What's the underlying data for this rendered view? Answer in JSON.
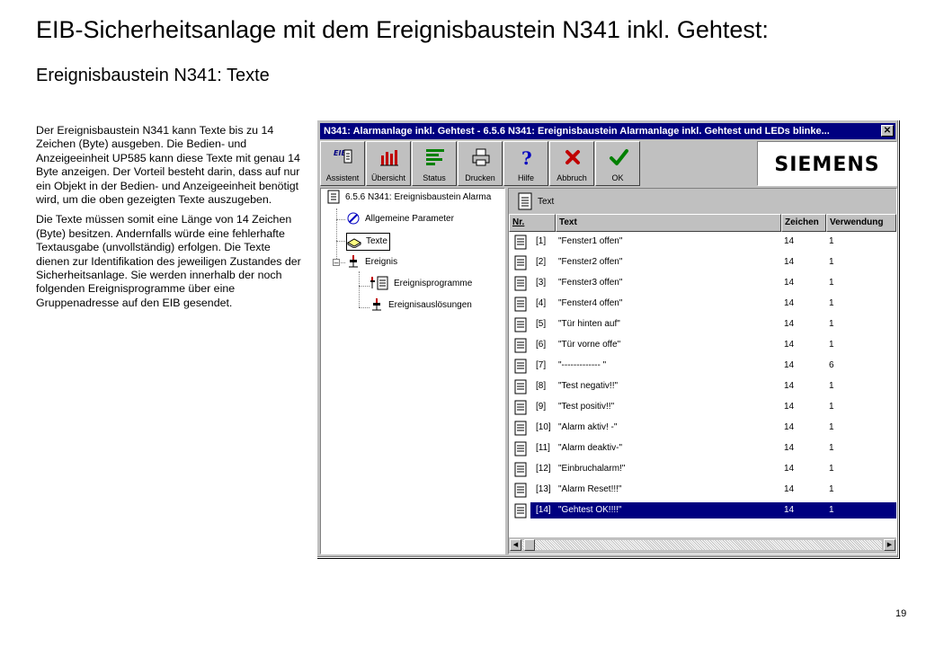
{
  "slide": {
    "title": "EIB-Sicherheitsanlage mit dem Ereignisbaustein N341 inkl. Gehtest:",
    "subtitle": "Ereignisbaustein N341: Texte",
    "paragraph1": "Der Ereignisbaustein N341 kann Texte bis zu 14 Zeichen (Byte) ausgeben. Die Bedien- und Anzeigeeinheit UP585 kann diese Texte mit genau 14 Byte anzeigen. Der Vorteil besteht darin, dass auf nur ein Objekt in der Bedien- und Anzeigeeinheit benötigt wird, um die oben gezeigten Texte auszugeben.",
    "paragraph2": "Die Texte müssen somit eine Länge von 14 Zeichen (Byte) besitzen. Andernfalls würde eine fehlerhafte Textausgabe (unvollständig) erfolgen. Die Texte dienen zur Identifikation des jeweiligen Zustandes der Sicherheitsanlage. Sie werden innerhalb der noch folgenden Ereignisprogramme über eine Gruppenadresse auf den EIB gesendet.",
    "page_number": "19"
  },
  "window": {
    "title": "N341: Alarmanlage inkl. Gehtest - 6.5.6  N341: Ereignisbaustein Alarmanlage inkl. Gehtest und LEDs blinke...",
    "close_glyph": "✕",
    "logo": "SIEMENS"
  },
  "toolbar": {
    "buttons": [
      {
        "label": "Assistent",
        "icon": "eib-assistant-icon"
      },
      {
        "label": "Übersicht",
        "icon": "overview-chart-icon"
      },
      {
        "label": "Status",
        "icon": "status-bars-icon"
      },
      {
        "label": "Drucken",
        "icon": "printer-icon"
      },
      {
        "label": "Hilfe",
        "icon": "help-question-icon"
      },
      {
        "label": "Abbruch",
        "icon": "cancel-x-icon"
      },
      {
        "label": "OK",
        "icon": "ok-check-icon"
      }
    ]
  },
  "tree": {
    "root": "6.5.6  N341: Ereignisbaustein Alarma",
    "items": [
      {
        "label": "Allgemeine Parameter"
      },
      {
        "label": "Texte"
      },
      {
        "label": "Ereignis"
      },
      {
        "label": "Ereignisprogramme"
      },
      {
        "label": "Ereignisauslösungen"
      }
    ]
  },
  "panel": {
    "header_label": "Text",
    "columns": [
      "Nr.",
      "Text",
      "Zeichen",
      "Verwendung"
    ],
    "rows": [
      {
        "nr": "[1]",
        "text": "\"Fenster1 offen\"",
        "zeichen": "14",
        "verwendung": "1"
      },
      {
        "nr": "[2]",
        "text": "\"Fenster2 offen\"",
        "zeichen": "14",
        "verwendung": "1"
      },
      {
        "nr": "[3]",
        "text": "\"Fenster3 offen\"",
        "zeichen": "14",
        "verwendung": "1"
      },
      {
        "nr": "[4]",
        "text": "\"Fenster4 offen\"",
        "zeichen": "14",
        "verwendung": "1"
      },
      {
        "nr": "[5]",
        "text": "\"Tür hinten auf\"",
        "zeichen": "14",
        "verwendung": "1"
      },
      {
        "nr": "[6]",
        "text": "\"Tür vorne offe\"",
        "zeichen": "14",
        "verwendung": "1"
      },
      {
        "nr": "[7]",
        "text": "\"------------- \"",
        "zeichen": "14",
        "verwendung": "6"
      },
      {
        "nr": "[8]",
        "text": "\"Test negativ!!\"",
        "zeichen": "14",
        "verwendung": "1"
      },
      {
        "nr": "[9]",
        "text": "\"Test positiv!!\"",
        "zeichen": "14",
        "verwendung": "1"
      },
      {
        "nr": "[10]",
        "text": "\"Alarm aktiv! -\"",
        "zeichen": "14",
        "verwendung": "1"
      },
      {
        "nr": "[11]",
        "text": "\"Alarm deaktiv-\"",
        "zeichen": "14",
        "verwendung": "1"
      },
      {
        "nr": "[12]",
        "text": "\"Einbruchalarm!\"",
        "zeichen": "14",
        "verwendung": "1"
      },
      {
        "nr": "[13]",
        "text": "\"Alarm Reset!!!\"",
        "zeichen": "14",
        "verwendung": "1"
      },
      {
        "nr": "[14]",
        "text": "\"Gehtest OK!!!!\"",
        "zeichen": "14",
        "verwendung": "1"
      }
    ],
    "selected_row": 14,
    "scroll_left_glyph": "◀",
    "scroll_right_glyph": "▶"
  },
  "colors": {
    "titlebar": "#000080",
    "selection": "#000080",
    "window_face": "#c0c0c0"
  }
}
